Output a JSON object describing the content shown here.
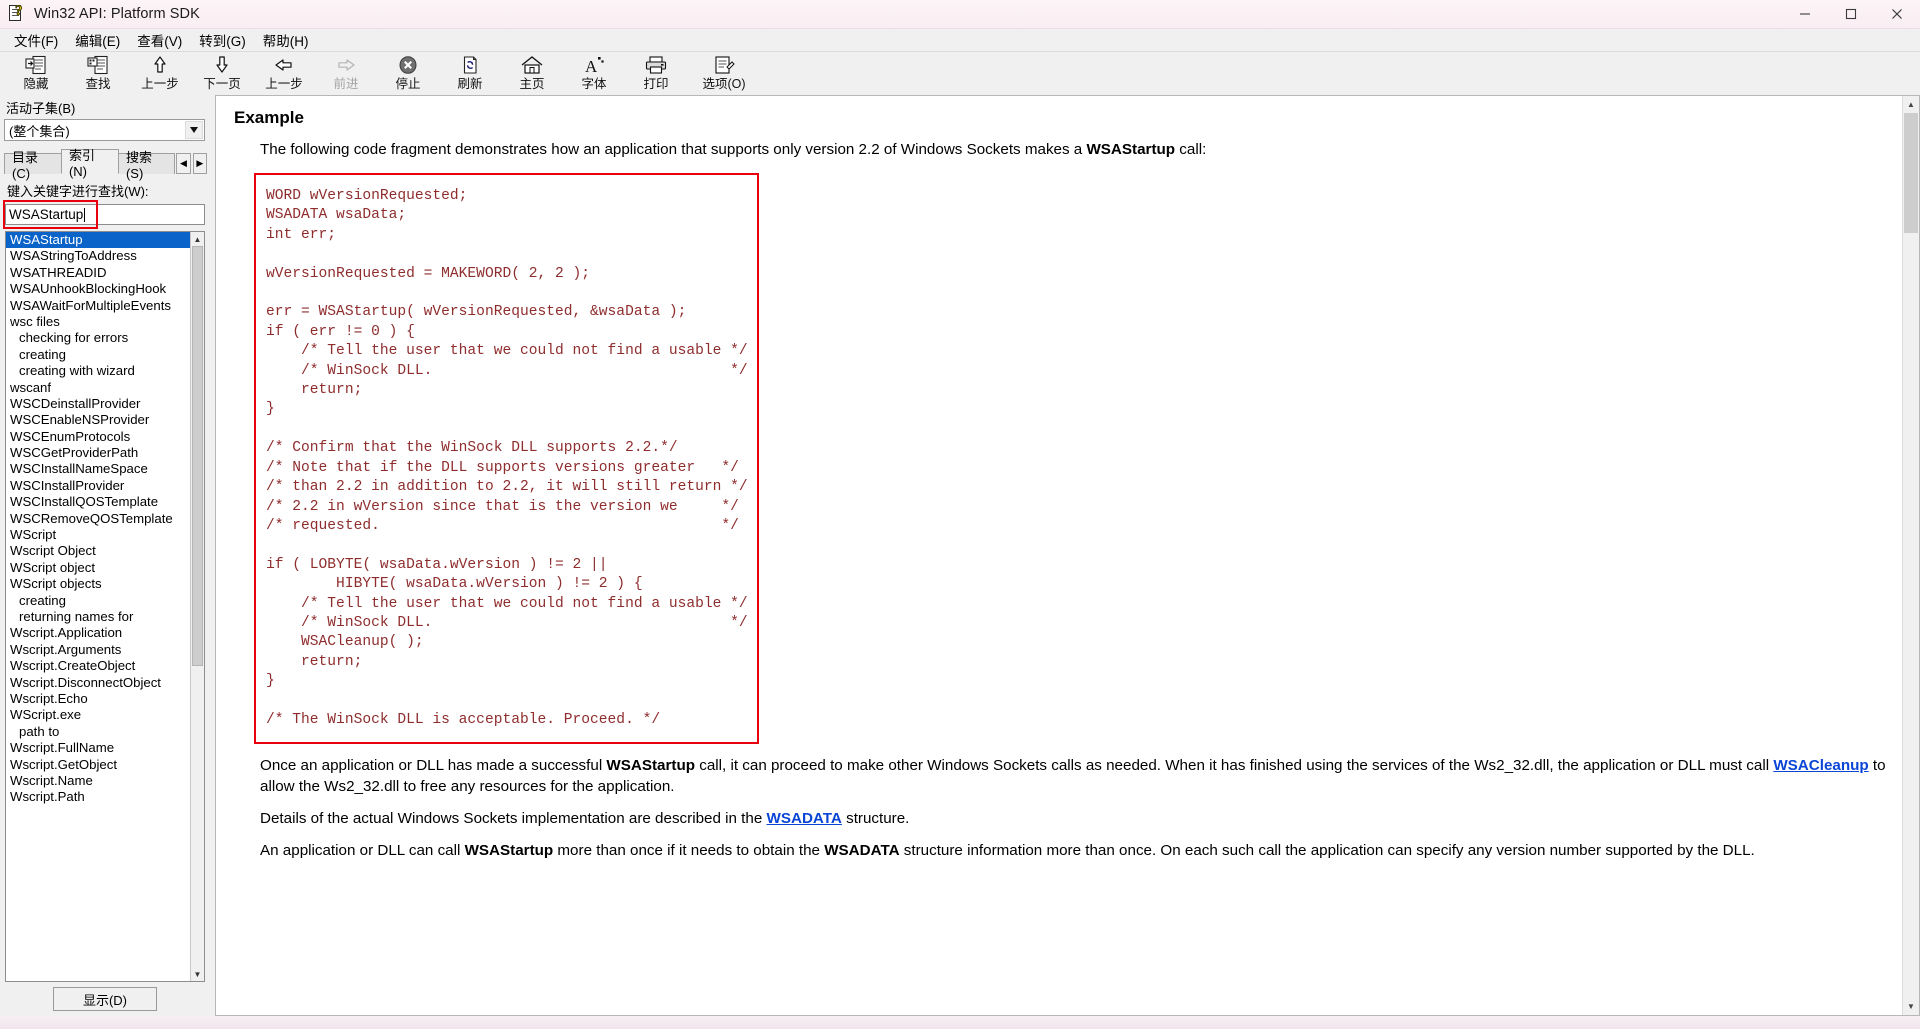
{
  "window": {
    "title": "Win32 API: Platform SDK",
    "icon": "help-book-icon",
    "minimize_label": "minimize",
    "maximize_label": "maximize",
    "close_label": "close"
  },
  "menu": [
    {
      "label": "文件(F)",
      "name": "menu-file"
    },
    {
      "label": "编辑(E)",
      "name": "menu-edit"
    },
    {
      "label": "查看(V)",
      "name": "menu-view"
    },
    {
      "label": "转到(G)",
      "name": "menu-goto"
    },
    {
      "label": "帮助(H)",
      "name": "menu-help"
    }
  ],
  "toolbar": [
    {
      "label": "隐藏",
      "icon": "hide-pane-icon",
      "disabled": false
    },
    {
      "label": "查找",
      "icon": "find-icon",
      "disabled": false
    },
    {
      "label": "上一步",
      "icon": "arrow-up-icon",
      "disabled": false
    },
    {
      "label": "下一页",
      "icon": "arrow-down-icon",
      "disabled": false
    },
    {
      "label": "上一步",
      "icon": "arrow-left-icon",
      "disabled": false
    },
    {
      "label": "前进",
      "icon": "arrow-right-icon",
      "disabled": true
    },
    {
      "label": "停止",
      "icon": "stop-icon",
      "disabled": false
    },
    {
      "label": "刷新",
      "icon": "refresh-icon",
      "disabled": false
    },
    {
      "label": "主页",
      "icon": "home-icon",
      "disabled": false
    },
    {
      "label": "字体",
      "icon": "font-icon",
      "disabled": false
    },
    {
      "label": "打印",
      "icon": "print-icon",
      "disabled": false
    },
    {
      "label": "选项(O)",
      "icon": "options-icon",
      "disabled": false
    }
  ],
  "sidebar": {
    "subset_label": "活动子集(B)",
    "subset_value": "(整个集合)",
    "tabs": [
      {
        "label": "目录(C)",
        "name": "tab-contents",
        "active": false
      },
      {
        "label": "索引(N)",
        "name": "tab-index",
        "active": true
      },
      {
        "label": "搜索(S)",
        "name": "tab-search",
        "active": false
      }
    ],
    "tab_scroll_left": "◀",
    "tab_scroll_right": "▶",
    "keyword_label": "键入关键字进行查找(W):",
    "keyword_value": "WSAStartup",
    "keyword_placeholder": "",
    "highlight_color": "#e8000d",
    "selected_index": 0,
    "items": [
      {
        "label": "WSAStartup",
        "indent": false
      },
      {
        "label": "WSAStringToAddress",
        "indent": false
      },
      {
        "label": "WSATHREADID",
        "indent": false
      },
      {
        "label": "WSAUnhookBlockingHook",
        "indent": false
      },
      {
        "label": "WSAWaitForMultipleEvents",
        "indent": false
      },
      {
        "label": "wsc files",
        "indent": false
      },
      {
        "label": "checking for errors",
        "indent": true
      },
      {
        "label": "creating",
        "indent": true
      },
      {
        "label": "creating with wizard",
        "indent": true
      },
      {
        "label": "wscanf",
        "indent": false
      },
      {
        "label": "WSCDeinstallProvider",
        "indent": false
      },
      {
        "label": "WSCEnableNSProvider",
        "indent": false
      },
      {
        "label": "WSCEnumProtocols",
        "indent": false
      },
      {
        "label": "WSCGetProviderPath",
        "indent": false
      },
      {
        "label": "WSCInstallNameSpace",
        "indent": false
      },
      {
        "label": "WSCInstallProvider",
        "indent": false
      },
      {
        "label": "WSCInstallQOSTemplate",
        "indent": false
      },
      {
        "label": "WSCRemoveQOSTemplate",
        "indent": false
      },
      {
        "label": "WScript",
        "indent": false
      },
      {
        "label": "Wscript Object",
        "indent": false
      },
      {
        "label": "WScript object",
        "indent": false
      },
      {
        "label": "WScript objects",
        "indent": false
      },
      {
        "label": "creating",
        "indent": true
      },
      {
        "label": "returning names for",
        "indent": true
      },
      {
        "label": "Wscript.Application",
        "indent": false
      },
      {
        "label": "Wscript.Arguments",
        "indent": false
      },
      {
        "label": "Wscript.CreateObject",
        "indent": false
      },
      {
        "label": "Wscript.DisconnectObject",
        "indent": false
      },
      {
        "label": "Wscript.Echo",
        "indent": false
      },
      {
        "label": "WScript.exe",
        "indent": false
      },
      {
        "label": "path to",
        "indent": true
      },
      {
        "label": "Wscript.FullName",
        "indent": false
      },
      {
        "label": "Wscript.GetObject",
        "indent": false
      },
      {
        "label": "Wscript.Name",
        "indent": false
      },
      {
        "label": "Wscript.Path",
        "indent": false
      }
    ],
    "show_button": "显示(D)"
  },
  "content": {
    "heading": "Example",
    "intro_before": "The following code fragment demonstrates how an application that supports only version 2.2 of Windows Sockets makes a ",
    "intro_bold": "WSAStartup",
    "intro_after": " call:",
    "code": "WORD wVersionRequested;\nWSADATA wsaData;\nint err;\n\nwVersionRequested = MAKEWORD( 2, 2 );\n\nerr = WSAStartup( wVersionRequested, &wsaData );\nif ( err != 0 ) {\n    /* Tell the user that we could not find a usable */\n    /* WinSock DLL.                                  */\n    return;\n}\n\n/* Confirm that the WinSock DLL supports 2.2.*/\n/* Note that if the DLL supports versions greater   */\n/* than 2.2 in addition to 2.2, it will still return */\n/* 2.2 in wVersion since that is the version we     */\n/* requested.                                       */\n\nif ( LOBYTE( wsaData.wVersion ) != 2 ||\n        HIBYTE( wsaData.wVersion ) != 2 ) {\n    /* Tell the user that we could not find a usable */\n    /* WinSock DLL.                                  */\n    WSACleanup( );\n    return;\n}\n\n/* The WinSock DLL is acceptable. Proceed. */",
    "code_color": "#8f2d2d",
    "code_border_color": "#e8000d",
    "p1_a": "Once an application or DLL has made a successful ",
    "p1_b": "WSAStartup",
    "p1_c": " call, it can proceed to make other Windows Sockets calls as needed. When it has finished using the services of the Ws2_32.dll, the application or DLL must call ",
    "p1_link": "WSACleanup",
    "p1_d": " to allow the Ws2_32.dll to free any resources for the application.",
    "p2_a": "Details of the actual Windows Sockets implementation are described in the ",
    "p2_link": "WSADATA",
    "p2_b": " structure.",
    "p3_a": "An application or DLL can call ",
    "p3_b": "WSAStartup",
    "p3_c": " more than once if it needs to obtain the ",
    "p3_d": "WSADATA",
    "p3_e": " structure information more than once. On each such call the application can specify any version number supported by the DLL.",
    "link_color": "#0b45d6"
  }
}
